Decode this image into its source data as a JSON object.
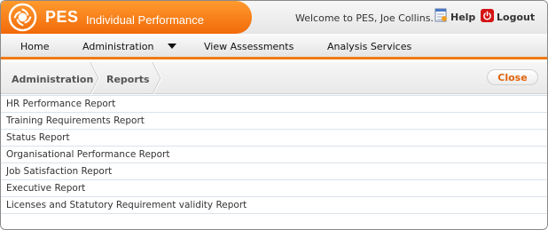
{
  "header": {
    "brand": "PES",
    "subtitle": "Individual Performance",
    "welcome": "Welcome to PES, Joe Collins.",
    "help_label": "Help",
    "logout_label": "Logout"
  },
  "nav": {
    "items": [
      "Home",
      "Administration",
      "View Assessments",
      "Analysis Services"
    ]
  },
  "breadcrumb": {
    "items": [
      "Administration",
      "Reports"
    ],
    "close_label": "Close"
  },
  "reports": [
    "HR Performance Report",
    "Training Requirements Report",
    "Status Report",
    "Organisational Performance Report",
    "Job Satisfaction Report",
    "Executive Report",
    "Licenses and Statutory Requirement validity Report"
  ],
  "colors": {
    "brand_orange": "#f26a0a",
    "accent_orange": "#f07a14",
    "close_text": "#e0640c",
    "logout_red": "#d41414"
  },
  "icons": [
    "logo-icon",
    "help-icon",
    "logout-icon",
    "chevron-down-icon"
  ]
}
